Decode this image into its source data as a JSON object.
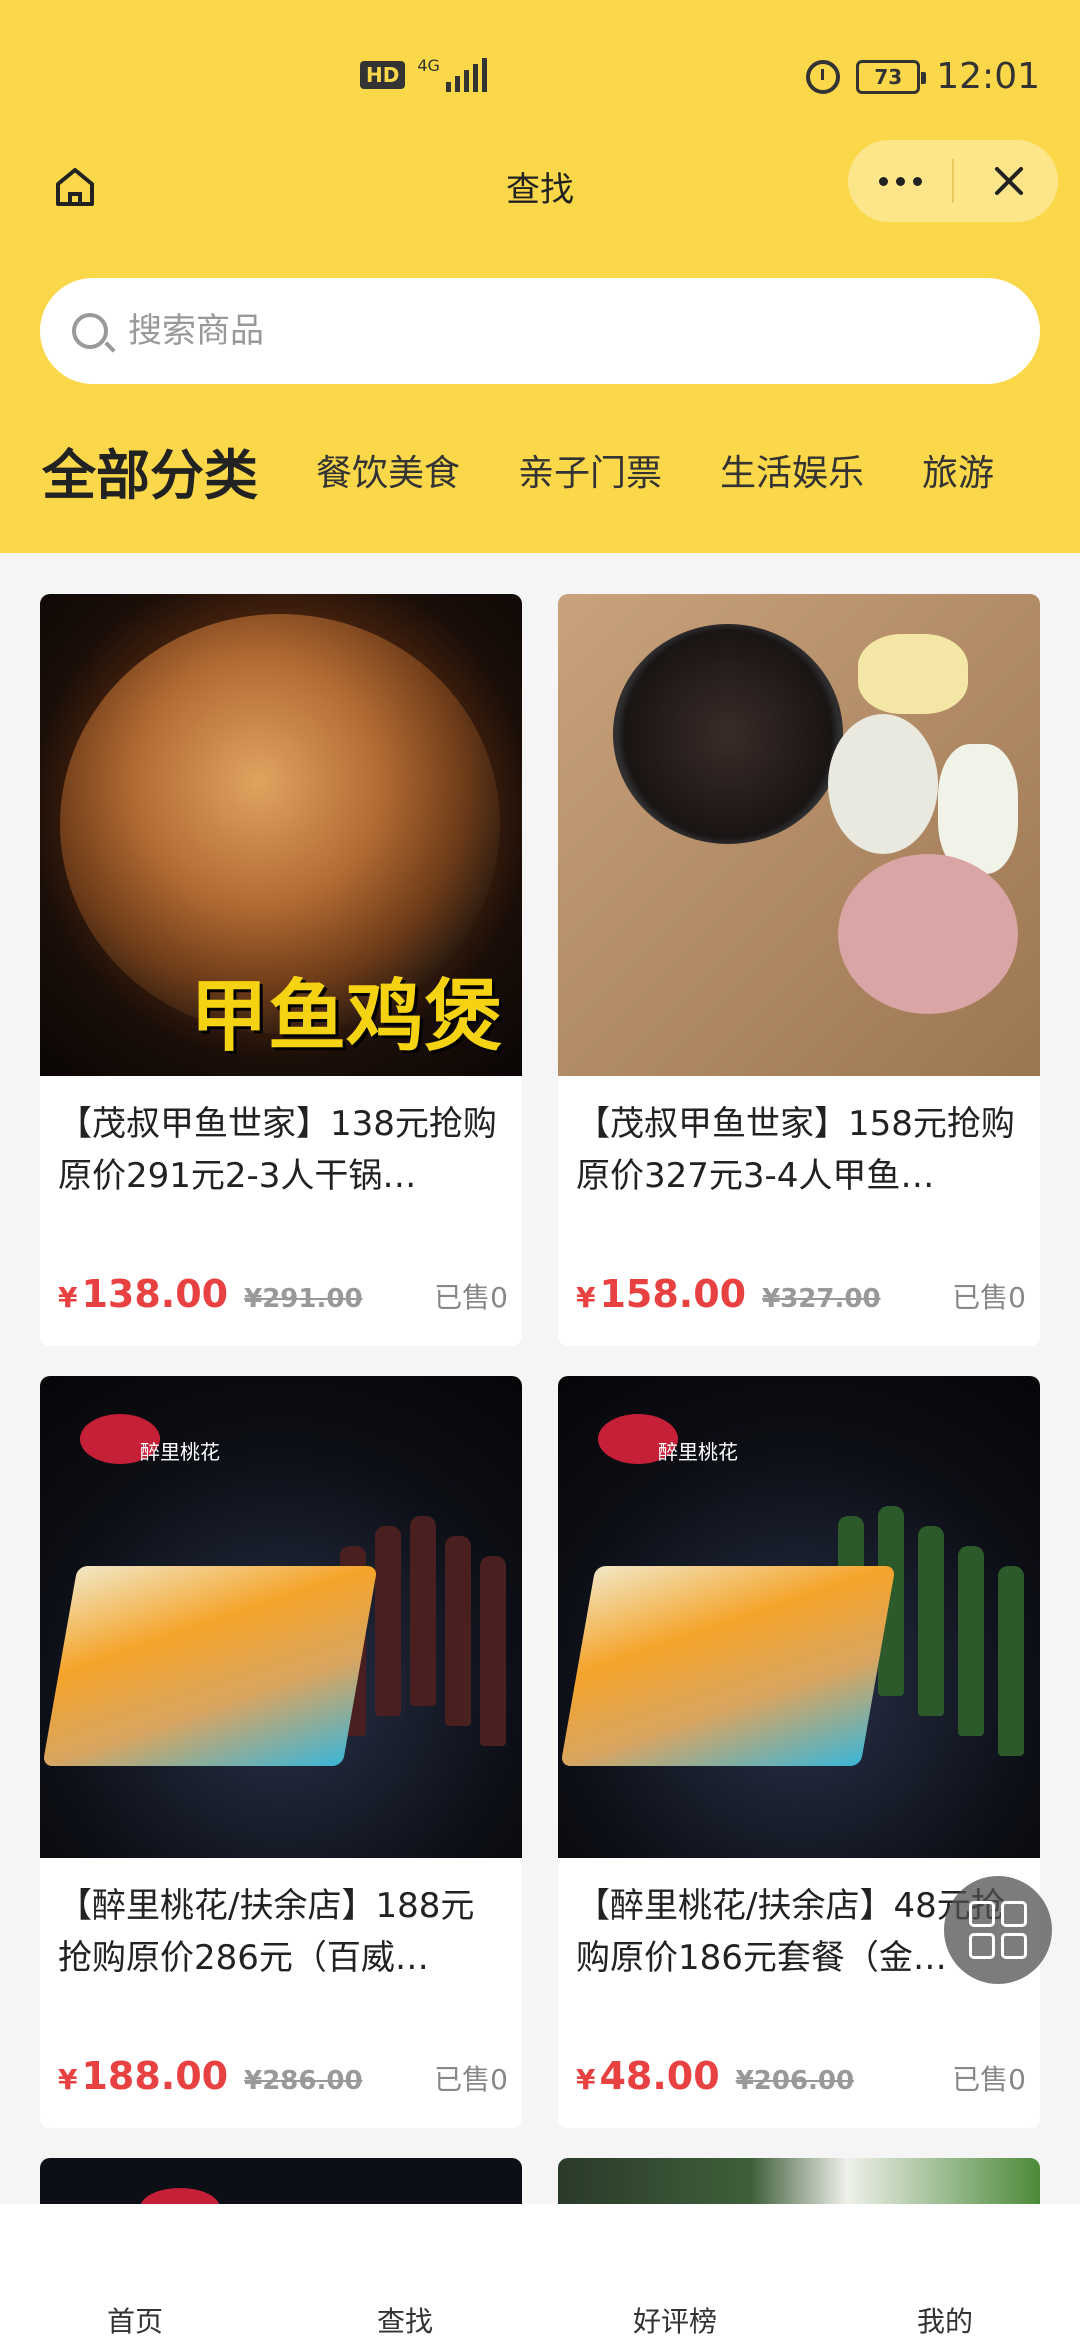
{
  "status_bar": {
    "hd": "HD",
    "network": "4G",
    "battery": "73",
    "time": "12:01"
  },
  "nav": {
    "title": "查找"
  },
  "search": {
    "placeholder": "搜索商品"
  },
  "categories": {
    "all": "全部分类",
    "items": [
      "餐饮美食",
      "亲子门票",
      "生活娱乐",
      "旅游"
    ]
  },
  "products": [
    {
      "title": "【茂叔甲鱼世家】138元抢购原价291元2-3人干锅…",
      "image_label": "甲鱼鸡煲",
      "yen": "¥",
      "price": "138.00",
      "original": "¥291.00",
      "sold": "已售0"
    },
    {
      "title": "【茂叔甲鱼世家】158元抢购原价327元3-4人甲鱼…",
      "yen": "¥",
      "price": "158.00",
      "original": "¥327.00",
      "sold": "已售0"
    },
    {
      "title": "【醉里桃花/扶余店】188元抢购原价286元（百威…",
      "logo_text": "醉里桃花",
      "yen": "¥",
      "price": "188.00",
      "original": "¥286.00",
      "sold": "已售0"
    },
    {
      "title": "【醉里桃花/扶余店】48元抢购原价186元套餐（金…",
      "logo_text": "醉里桃花",
      "yen": "¥",
      "price": "48.00",
      "original": "¥206.00",
      "sold": "已售0"
    }
  ],
  "bottom_nav": {
    "tabs": [
      "首页",
      "查找",
      "好评榜",
      "我的"
    ]
  },
  "colors": {
    "brand_yellow": "#fbd84a",
    "price_red": "#e84141"
  }
}
